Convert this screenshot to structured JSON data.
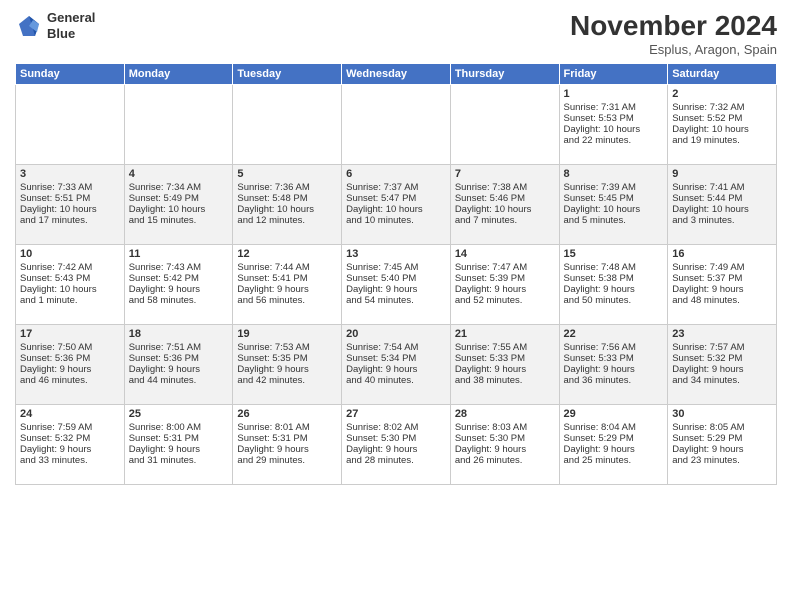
{
  "header": {
    "logo_line1": "General",
    "logo_line2": "Blue",
    "month": "November 2024",
    "location": "Esplus, Aragon, Spain"
  },
  "days_of_week": [
    "Sunday",
    "Monday",
    "Tuesday",
    "Wednesday",
    "Thursday",
    "Friday",
    "Saturday"
  ],
  "weeks": [
    [
      {
        "day": "",
        "text": ""
      },
      {
        "day": "",
        "text": ""
      },
      {
        "day": "",
        "text": ""
      },
      {
        "day": "",
        "text": ""
      },
      {
        "day": "",
        "text": ""
      },
      {
        "day": "1",
        "text": "Sunrise: 7:31 AM\nSunset: 5:53 PM\nDaylight: 10 hours\nand 22 minutes."
      },
      {
        "day": "2",
        "text": "Sunrise: 7:32 AM\nSunset: 5:52 PM\nDaylight: 10 hours\nand 19 minutes."
      }
    ],
    [
      {
        "day": "3",
        "text": "Sunrise: 7:33 AM\nSunset: 5:51 PM\nDaylight: 10 hours\nand 17 minutes."
      },
      {
        "day": "4",
        "text": "Sunrise: 7:34 AM\nSunset: 5:49 PM\nDaylight: 10 hours\nand 15 minutes."
      },
      {
        "day": "5",
        "text": "Sunrise: 7:36 AM\nSunset: 5:48 PM\nDaylight: 10 hours\nand 12 minutes."
      },
      {
        "day": "6",
        "text": "Sunrise: 7:37 AM\nSunset: 5:47 PM\nDaylight: 10 hours\nand 10 minutes."
      },
      {
        "day": "7",
        "text": "Sunrise: 7:38 AM\nSunset: 5:46 PM\nDaylight: 10 hours\nand 7 minutes."
      },
      {
        "day": "8",
        "text": "Sunrise: 7:39 AM\nSunset: 5:45 PM\nDaylight: 10 hours\nand 5 minutes."
      },
      {
        "day": "9",
        "text": "Sunrise: 7:41 AM\nSunset: 5:44 PM\nDaylight: 10 hours\nand 3 minutes."
      }
    ],
    [
      {
        "day": "10",
        "text": "Sunrise: 7:42 AM\nSunset: 5:43 PM\nDaylight: 10 hours\nand 1 minute."
      },
      {
        "day": "11",
        "text": "Sunrise: 7:43 AM\nSunset: 5:42 PM\nDaylight: 9 hours\nand 58 minutes."
      },
      {
        "day": "12",
        "text": "Sunrise: 7:44 AM\nSunset: 5:41 PM\nDaylight: 9 hours\nand 56 minutes."
      },
      {
        "day": "13",
        "text": "Sunrise: 7:45 AM\nSunset: 5:40 PM\nDaylight: 9 hours\nand 54 minutes."
      },
      {
        "day": "14",
        "text": "Sunrise: 7:47 AM\nSunset: 5:39 PM\nDaylight: 9 hours\nand 52 minutes."
      },
      {
        "day": "15",
        "text": "Sunrise: 7:48 AM\nSunset: 5:38 PM\nDaylight: 9 hours\nand 50 minutes."
      },
      {
        "day": "16",
        "text": "Sunrise: 7:49 AM\nSunset: 5:37 PM\nDaylight: 9 hours\nand 48 minutes."
      }
    ],
    [
      {
        "day": "17",
        "text": "Sunrise: 7:50 AM\nSunset: 5:36 PM\nDaylight: 9 hours\nand 46 minutes."
      },
      {
        "day": "18",
        "text": "Sunrise: 7:51 AM\nSunset: 5:36 PM\nDaylight: 9 hours\nand 44 minutes."
      },
      {
        "day": "19",
        "text": "Sunrise: 7:53 AM\nSunset: 5:35 PM\nDaylight: 9 hours\nand 42 minutes."
      },
      {
        "day": "20",
        "text": "Sunrise: 7:54 AM\nSunset: 5:34 PM\nDaylight: 9 hours\nand 40 minutes."
      },
      {
        "day": "21",
        "text": "Sunrise: 7:55 AM\nSunset: 5:33 PM\nDaylight: 9 hours\nand 38 minutes."
      },
      {
        "day": "22",
        "text": "Sunrise: 7:56 AM\nSunset: 5:33 PM\nDaylight: 9 hours\nand 36 minutes."
      },
      {
        "day": "23",
        "text": "Sunrise: 7:57 AM\nSunset: 5:32 PM\nDaylight: 9 hours\nand 34 minutes."
      }
    ],
    [
      {
        "day": "24",
        "text": "Sunrise: 7:59 AM\nSunset: 5:32 PM\nDaylight: 9 hours\nand 33 minutes."
      },
      {
        "day": "25",
        "text": "Sunrise: 8:00 AM\nSunset: 5:31 PM\nDaylight: 9 hours\nand 31 minutes."
      },
      {
        "day": "26",
        "text": "Sunrise: 8:01 AM\nSunset: 5:31 PM\nDaylight: 9 hours\nand 29 minutes."
      },
      {
        "day": "27",
        "text": "Sunrise: 8:02 AM\nSunset: 5:30 PM\nDaylight: 9 hours\nand 28 minutes."
      },
      {
        "day": "28",
        "text": "Sunrise: 8:03 AM\nSunset: 5:30 PM\nDaylight: 9 hours\nand 26 minutes."
      },
      {
        "day": "29",
        "text": "Sunrise: 8:04 AM\nSunset: 5:29 PM\nDaylight: 9 hours\nand 25 minutes."
      },
      {
        "day": "30",
        "text": "Sunrise: 8:05 AM\nSunset: 5:29 PM\nDaylight: 9 hours\nand 23 minutes."
      }
    ]
  ]
}
